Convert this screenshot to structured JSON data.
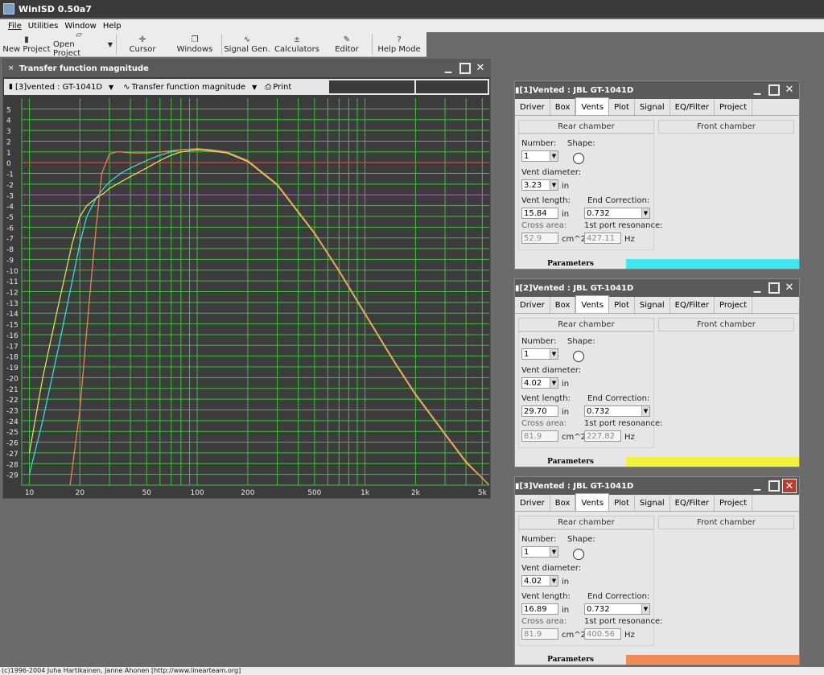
{
  "app": {
    "title": "WinISD 0.50a7"
  },
  "menu": [
    "File",
    "Utilities",
    "Window",
    "Help"
  ],
  "toolbar": [
    {
      "label": "New Project",
      "icon": "new-project-icon",
      "glyph": "▮"
    },
    {
      "label": "Open Project",
      "icon": "open-project-icon",
      "glyph": "▱"
    },
    {
      "label": "Cursor",
      "icon": "cursor-icon",
      "glyph": "✛"
    },
    {
      "label": "Windows",
      "icon": "windows-icon",
      "glyph": "❐"
    },
    {
      "label": "Signal Gen.",
      "icon": "signal-gen-icon",
      "glyph": "∿"
    },
    {
      "label": "Calculators",
      "icon": "calculators-icon",
      "glyph": "±"
    },
    {
      "label": "Editor",
      "icon": "editor-icon",
      "glyph": "✎"
    },
    {
      "label": "Help Mode",
      "icon": "help-mode-icon",
      "glyph": "?"
    }
  ],
  "graph_window": {
    "title": "Transfer function magnitude",
    "project_select": "[3]vented : GT-1041D",
    "graph_select": "Transfer function magnitude",
    "print_label": "Print"
  },
  "chart_data": {
    "type": "line",
    "x_scale": "log",
    "xlim": [
      9,
      5500
    ],
    "ylim": [
      -30,
      6
    ],
    "x_tick_labels": [
      "10",
      "20",
      "50",
      "100",
      "200",
      "500",
      "1k",
      "2k",
      "5k"
    ],
    "x_ticks": [
      10,
      20,
      50,
      100,
      200,
      500,
      1000,
      2000,
      5000
    ],
    "y_ticks": [
      5,
      4,
      3,
      2,
      1,
      0,
      -1,
      -2,
      -3,
      -4,
      -5,
      -6,
      -7,
      -8,
      -9,
      -10,
      -11,
      -12,
      -13,
      -14,
      -15,
      -16,
      -17,
      -18,
      -19,
      -20,
      -21,
      -22,
      -23,
      -24,
      -25,
      -26,
      -27,
      -28,
      -29
    ],
    "reference_lines": [
      {
        "y": 0,
        "color": "#e04040"
      },
      {
        "y": -3,
        "color": "#b040c0"
      }
    ],
    "grid": true,
    "background": "#3c3c3c",
    "grid_color": "#3fbf3f",
    "series": [
      {
        "color": "#40e0e8",
        "x": [
          10,
          12,
          15,
          18,
          20,
          22,
          25,
          28,
          30,
          35,
          40,
          50,
          60,
          70,
          80,
          100,
          120,
          150,
          200,
          300,
          500,
          700,
          1000,
          1500,
          2000,
          3000,
          4000,
          5500
        ],
        "y": [
          -29,
          -24,
          -17,
          -11,
          -7.5,
          -5,
          -3.3,
          -2.3,
          -1.8,
          -1.0,
          -0.5,
          0.2,
          0.7,
          1.0,
          1.2,
          1.3,
          1.2,
          1.0,
          0.2,
          -2.0,
          -6.5,
          -10.0,
          -14.0,
          -18.5,
          -21.5,
          -25.2,
          -27.8,
          -30
        ]
      },
      {
        "color": "#e8e860",
        "x": [
          10,
          12,
          15,
          18,
          20,
          22,
          25,
          28,
          30,
          35,
          40,
          50,
          60,
          70,
          80,
          100,
          120,
          150,
          200,
          300,
          500,
          700,
          1000,
          1500,
          2000,
          3000,
          4000,
          5500
        ],
        "y": [
          -27,
          -20,
          -13,
          -7.5,
          -5,
          -4,
          -3.3,
          -2.8,
          -2.4,
          -1.8,
          -1.3,
          -0.5,
          0.2,
          0.7,
          1.0,
          1.2,
          1.1,
          0.9,
          0.1,
          -2.1,
          -6.6,
          -10.1,
          -14.1,
          -18.6,
          -21.6,
          -25.3,
          -27.9,
          -30
        ]
      },
      {
        "color": "#f08a55",
        "x": [
          10,
          15,
          20,
          23,
          25,
          27,
          30,
          33,
          35,
          40,
          50,
          60,
          70,
          80,
          100,
          120,
          150,
          200,
          300,
          500,
          700,
          1000,
          1500,
          2000,
          3000,
          4000,
          5500
        ],
        "y": [
          -50,
          -38,
          -23,
          -12,
          -6,
          -1,
          0.8,
          1.0,
          1.0,
          0.9,
          0.9,
          1.0,
          1.1,
          1.2,
          1.3,
          1.2,
          1.0,
          0.2,
          -2.0,
          -6.5,
          -10.0,
          -14.0,
          -18.5,
          -21.5,
          -25.2,
          -27.8,
          -30
        ]
      }
    ]
  },
  "param_windows": [
    {
      "title": "[1]Vented : JBL GT-1041D",
      "tabs": [
        "Driver",
        "Box",
        "Vents",
        "Plot",
        "Signal",
        "EQ/Filter",
        "Project"
      ],
      "active_tab": "Vents",
      "rear_chamber": "Rear chamber",
      "front_chamber": "Front chamber",
      "number_label": "Number:",
      "number": "1",
      "shape_label": "Shape:",
      "vent_diameter_label": "Vent diameter:",
      "vent_diameter": "3.23",
      "diameter_unit": "in",
      "vent_length_label": "Vent length:",
      "vent_length": "15.84",
      "length_unit": "in",
      "end_correction_label": "End Correction:",
      "end_correction": "0.732",
      "cross_area_label": "Cross area:",
      "cross_area": "52.9",
      "area_unit": "cm^2",
      "resonance_label": "1st port resonance:",
      "resonance": "427.11",
      "resonance_unit": "Hz",
      "footer_label": "Parameters",
      "color": "#3ee8f0",
      "close_style": "normal"
    },
    {
      "title": "[2]Vented : JBL GT-1041D",
      "tabs": [
        "Driver",
        "Box",
        "Vents",
        "Plot",
        "Signal",
        "EQ/Filter",
        "Project"
      ],
      "active_tab": "Vents",
      "rear_chamber": "Rear chamber",
      "front_chamber": "Front chamber",
      "number_label": "Number:",
      "number": "1",
      "shape_label": "Shape:",
      "vent_diameter_label": "Vent diameter:",
      "vent_diameter": "4.02",
      "diameter_unit": "in",
      "vent_length_label": "Vent length:",
      "vent_length": "29.70",
      "length_unit": "in",
      "end_correction_label": "End Correction:",
      "end_correction": "0.732",
      "cross_area_label": "Cross area:",
      "cross_area": "81.9",
      "area_unit": "cm^2",
      "resonance_label": "1st port resonance:",
      "resonance": "227.82",
      "resonance_unit": "Hz",
      "footer_label": "Parameters",
      "color": "#f2f23a",
      "close_style": "normal"
    },
    {
      "title": "[3]Vented : JBL GT-1041D",
      "tabs": [
        "Driver",
        "Box",
        "Vents",
        "Plot",
        "Signal",
        "EQ/Filter",
        "Project"
      ],
      "active_tab": "Vents",
      "rear_chamber": "Rear chamber",
      "front_chamber": "Front chamber",
      "number_label": "Number:",
      "number": "1",
      "shape_label": "Shape:",
      "vent_diameter_label": "Vent diameter:",
      "vent_diameter": "4.02",
      "diameter_unit": "in",
      "vent_length_label": "Vent length:",
      "vent_length": "16.89",
      "length_unit": "in",
      "end_correction_label": "End Correction:",
      "end_correction": "0.732",
      "cross_area_label": "Cross area:",
      "cross_area": "81.9",
      "area_unit": "cm^2",
      "resonance_label": "1st port resonance:",
      "resonance": "400.56",
      "resonance_unit": "Hz",
      "footer_label": "Parameters",
      "color": "#f28a55",
      "close_style": "red"
    }
  ],
  "status": "(c)1996-2004 Juha Hartikainen, Janne Ahonen [http://www.linearteam.org]"
}
